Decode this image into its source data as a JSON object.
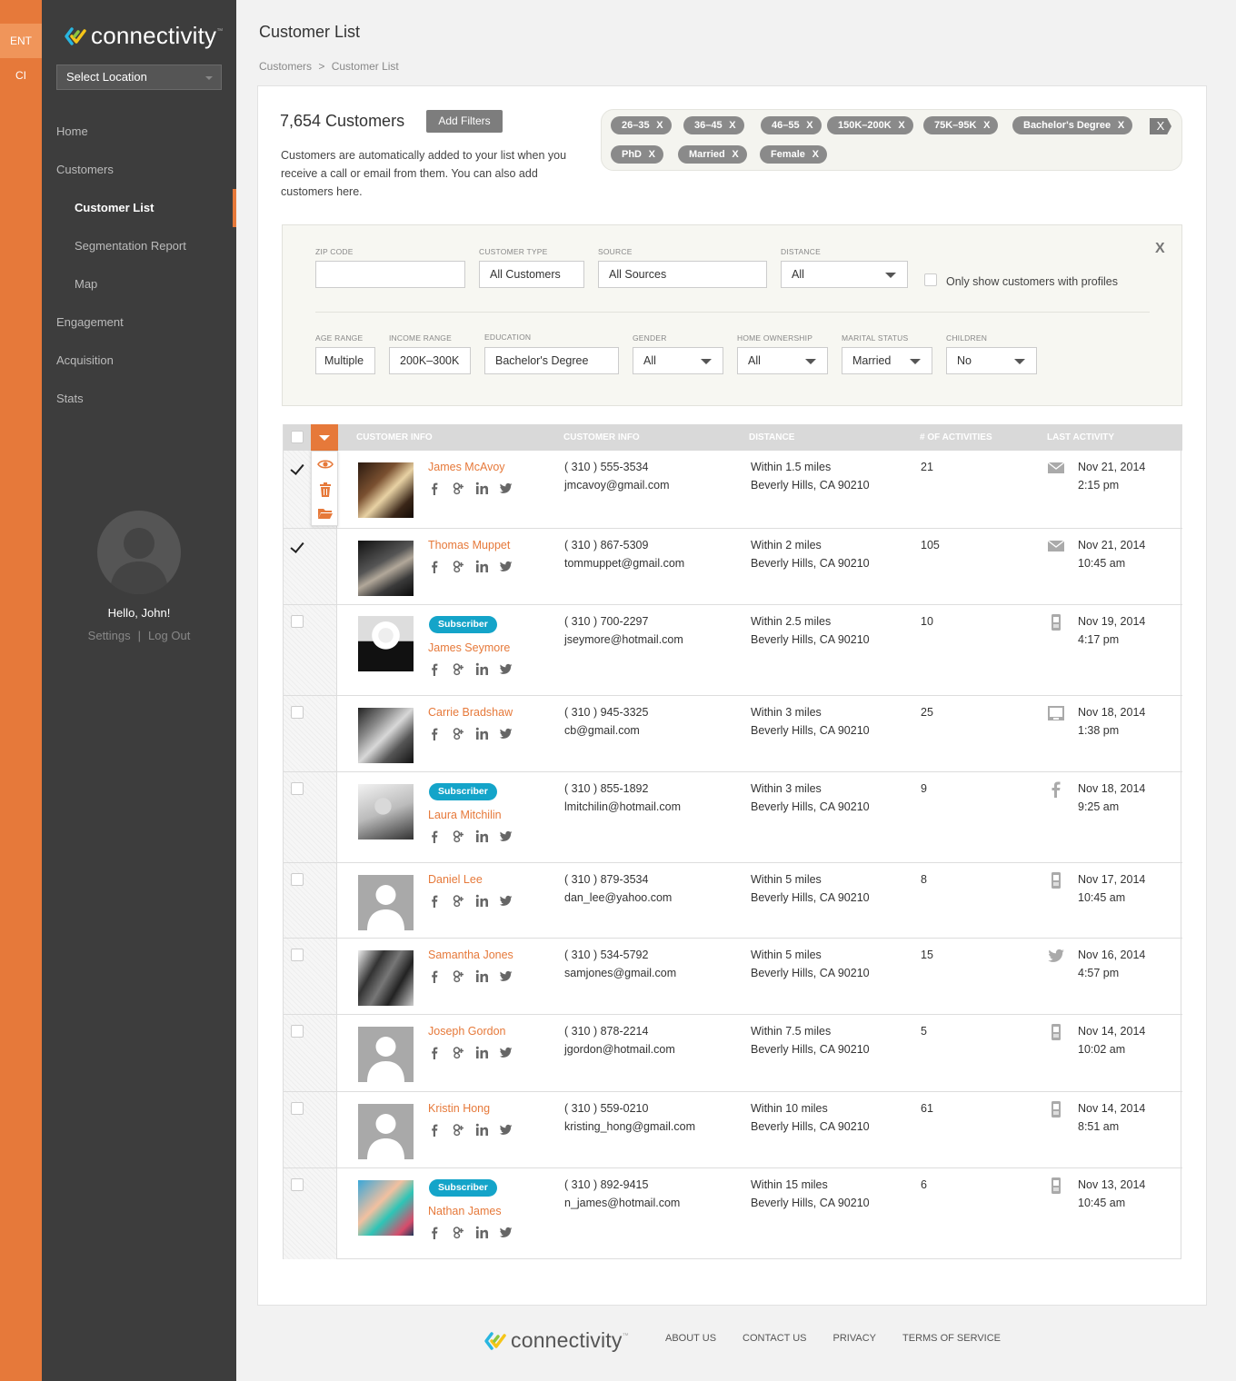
{
  "env": {
    "items": [
      "ENT",
      "CI"
    ]
  },
  "sidebar": {
    "logo": "connectivity",
    "logo_tm": "™",
    "location_select": "Select Location",
    "nav": [
      "Home",
      "Customers",
      "Customer List",
      "Segmentation Report",
      "Map",
      "Engagement",
      "Acquisition",
      "Stats"
    ],
    "greeting": "Hello, John!",
    "settings": "Settings",
    "separator": "|",
    "logout": "Log Out"
  },
  "header": {
    "title": "Customer List",
    "breadcrumb": [
      "Customers",
      ">",
      "Customer List"
    ]
  },
  "summary": {
    "count": "7,654 Customers",
    "add_filters": "Add Filters",
    "intro": "Customers are automatically added to your list when you receive a call or email from them. You can also add customers here."
  },
  "filter_tags": [
    "26–35",
    "36–45",
    "46–55",
    "150K–200K",
    "75K–95K",
    "Bachelor's Degree",
    "PhD",
    "Married",
    "Female"
  ],
  "tag_close": "X",
  "filters": {
    "zip_label": "ZIP CODE",
    "zip_value": "",
    "customer_type_label": "CUSTOMER TYPE",
    "customer_type": "All Customers",
    "source_label": "SOURCE",
    "source": "All Sources",
    "distance_label": "DISTANCE",
    "distance": "All",
    "profiles_only": "Only show customers with profiles",
    "age_label": "AGE RANGE",
    "age": "Multiple",
    "income_label": "INCOME RANGE",
    "income": "200K–300K",
    "education_label": "EDUCATION",
    "education": "Bachelor's Degree",
    "gender_label": "GENDER",
    "gender": "All",
    "home_label": "HOME OWNERSHIP",
    "home": "All",
    "marital_label": "MARITAL STATUS",
    "marital": "Married",
    "children_label": "CHILDREN",
    "children": "No",
    "close": "X"
  },
  "table": {
    "headers": [
      "CUSTOMER INFO",
      "CUSTOMER INFO",
      "DISTANCE",
      "# OF ACTIVITIES",
      "LAST ACTIVITY"
    ],
    "rows": [
      {
        "name": "James McAvoy",
        "badge": "",
        "phone": "( 310 ) 555-3534",
        "email": "jmcavoy@gmail.com",
        "distance": "Within 1.5 miles",
        "city": "Beverly Hills, CA 90210",
        "activities": "21",
        "date": "Nov 21, 2014",
        "time": "2:15 pm",
        "activity_icon": "mail-icon",
        "checked": true
      },
      {
        "name": "Thomas Muppet",
        "badge": "",
        "phone": "( 310 ) 867-5309",
        "email": "tommuppet@gmail.com",
        "distance": "Within 2 miles",
        "city": "Beverly Hills, CA 90210",
        "activities": "105",
        "date": "Nov 21, 2014",
        "time": "10:45 am",
        "activity_icon": "mail-icon",
        "checked": true
      },
      {
        "name": "James Seymore",
        "badge": "Subscriber",
        "phone": "( 310 ) 700-2297",
        "email": "jseymore@hotmail.com",
        "distance": "Within 2.5 miles",
        "city": "Beverly Hills, CA 90210",
        "activities": "10",
        "date": "Nov 19, 2014",
        "time": "4:17 pm",
        "activity_icon": "mobile-icon",
        "checked": false
      },
      {
        "name": "Carrie Bradshaw",
        "badge": "",
        "phone": "( 310 ) 945-3325",
        "email": "cb@gmail.com",
        "distance": "Within 3 miles",
        "city": "Beverly Hills, CA 90210",
        "activities": "25",
        "date": "Nov 18, 2014",
        "time": "1:38 pm",
        "activity_icon": "web-icon",
        "checked": false
      },
      {
        "name": "Laura Mitchilin",
        "badge": "Subscriber",
        "phone": "( 310 ) 855-1892",
        "email": "lmitchilin@hotmail.com",
        "distance": "Within 3 miles",
        "city": "Beverly Hills, CA 90210",
        "activities": "9",
        "date": "Nov 18, 2014",
        "time": "9:25 am",
        "activity_icon": "facebook-icon",
        "checked": false
      },
      {
        "name": "Daniel Lee",
        "badge": "",
        "phone": "( 310 ) 879-3534",
        "email": "dan_lee@yahoo.com",
        "distance": "Within 5 miles",
        "city": "Beverly Hills, CA 90210",
        "activities": "8",
        "date": "Nov 17, 2014",
        "time": "10:45 am",
        "activity_icon": "mobile-icon",
        "checked": false
      },
      {
        "name": "Samantha Jones",
        "badge": "",
        "phone": "( 310 ) 534-5792",
        "email": "samjones@gmail.com",
        "distance": "Within 5 miles",
        "city": "Beverly Hills, CA 90210",
        "activities": "15",
        "date": "Nov 16, 2014",
        "time": "4:57 pm",
        "activity_icon": "twitter-icon",
        "checked": false
      },
      {
        "name": "Joseph Gordon",
        "badge": "",
        "phone": "( 310 ) 878-2214",
        "email": "jgordon@hotmail.com",
        "distance": "Within 7.5 miles",
        "city": "Beverly Hills, CA 90210",
        "activities": "5",
        "date": "Nov 14, 2014",
        "time": "10:02 am",
        "activity_icon": "mobile-icon",
        "checked": false
      },
      {
        "name": "Kristin Hong",
        "badge": "",
        "phone": "( 310 ) 559-0210",
        "email": "kristing_hong@gmail.com",
        "distance": "Within 10 miles",
        "city": "Beverly Hills, CA 90210",
        "activities": "61",
        "date": "Nov 14, 2014",
        "time": "8:51 am",
        "activity_icon": "mobile-icon",
        "checked": false
      },
      {
        "name": "Nathan James",
        "badge": "Subscriber",
        "phone": "( 310 ) 892-9415",
        "email": "n_james@hotmail.com",
        "distance": "Within 15 miles",
        "city": "Beverly Hills, CA 90210",
        "activities": "6",
        "date": "Nov 13, 2014",
        "time": "10:45 am",
        "activity_icon": "mobile-icon",
        "checked": false
      }
    ]
  },
  "footer": {
    "logo": "connectivity",
    "links": [
      "ABOUT US",
      "CONTACT US",
      "PRIVACY",
      "TERMS OF SERVICE"
    ]
  },
  "colors": {
    "accent": "#e6793a",
    "sidebar": "#3d3d3d",
    "badge": "#14a4c9"
  }
}
